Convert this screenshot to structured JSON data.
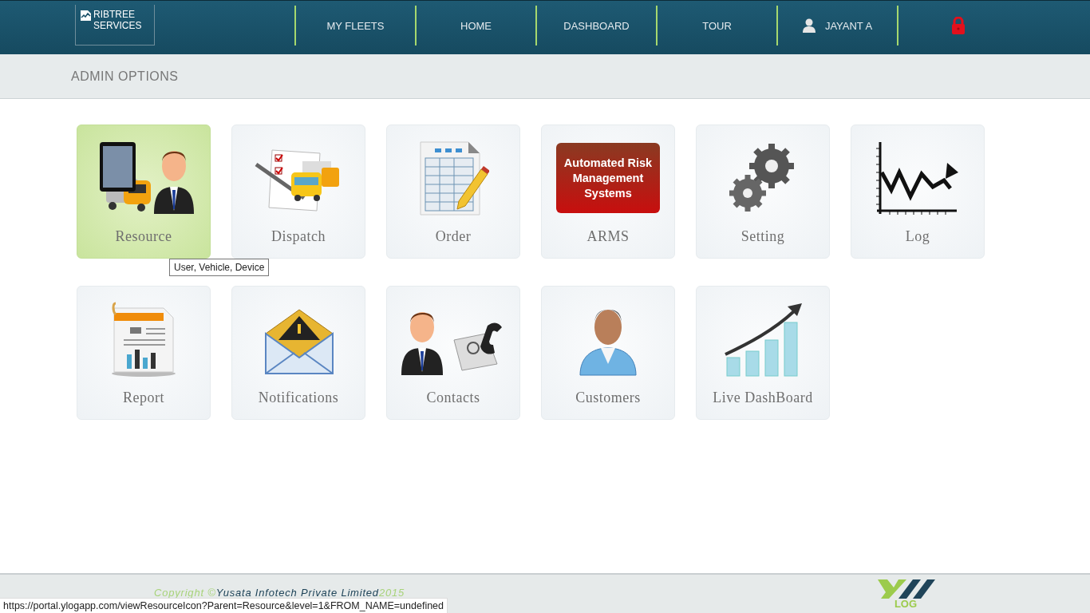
{
  "header": {
    "logo": {
      "line1": "RIBTREE",
      "line2": "SERVICES"
    },
    "nav": [
      {
        "label": "MY FLEETS",
        "kind": "link"
      },
      {
        "label": "HOME",
        "kind": "link"
      },
      {
        "label": "DASHBOARD",
        "kind": "link"
      },
      {
        "label": "TOUR",
        "kind": "link"
      },
      {
        "label": "JAYANT A",
        "kind": "user"
      },
      {
        "kind": "logout"
      }
    ]
  },
  "section_title": "ADMIN OPTIONS",
  "tiles": [
    {
      "label": "Resource",
      "kind": "resource",
      "selected": true,
      "tooltip": "User, Vehicle, Device"
    },
    {
      "label": "Dispatch",
      "kind": "dispatch",
      "selected": false
    },
    {
      "label": "Order",
      "kind": "order",
      "selected": false
    },
    {
      "label": "ARMS",
      "kind": "arms",
      "selected": false,
      "badge_lines": [
        "Automated Risk",
        "Management",
        "Systems"
      ]
    },
    {
      "label": "Setting",
      "kind": "setting",
      "selected": false
    },
    {
      "label": "Log",
      "kind": "log",
      "selected": false
    },
    {
      "label": "Report",
      "kind": "report",
      "selected": false
    },
    {
      "label": "Notifications",
      "kind": "notifications",
      "selected": false
    },
    {
      "label": "Contacts",
      "kind": "contacts",
      "selected": false
    },
    {
      "label": "Customers",
      "kind": "customers",
      "selected": false
    },
    {
      "label": "Live DashBoard",
      "kind": "live-dashboard",
      "selected": false
    }
  ],
  "footer": {
    "copyright_prefix": "Copyright ©",
    "company": "Yusata Infotech Private Limited",
    "year": "2015",
    "logo_text": "LOG"
  },
  "status_bar": "https://portal.ylogapp.com/viewResourceIcon?Parent=Resource&level=1&FROM_NAME=undefined"
}
